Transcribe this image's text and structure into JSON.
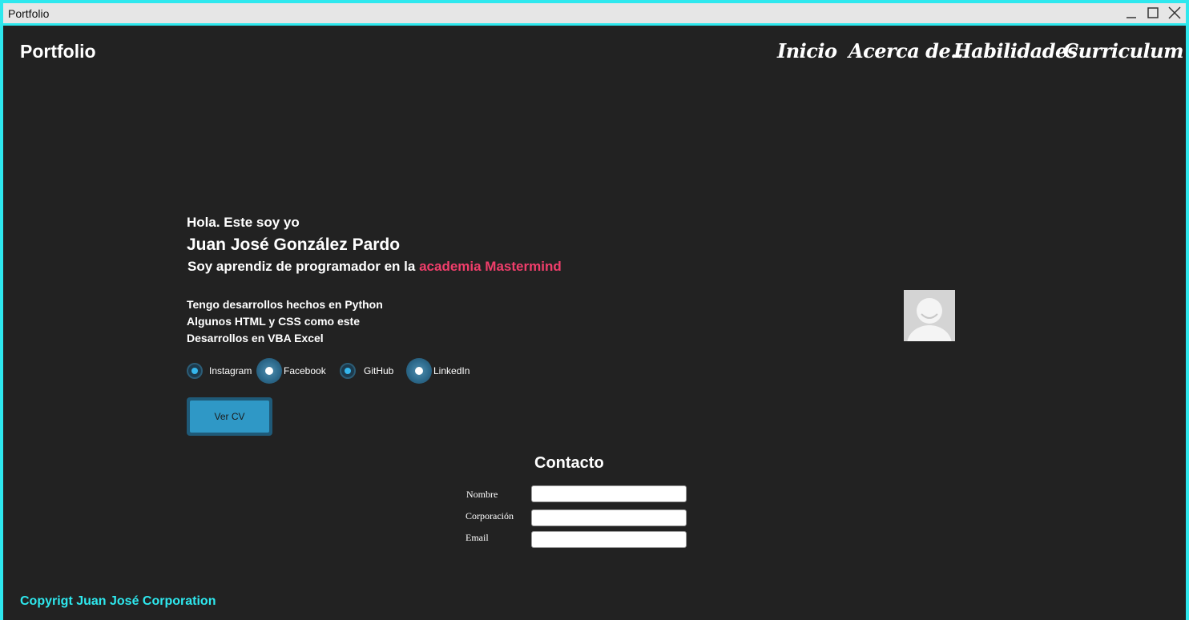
{
  "window": {
    "title": "Portfolio"
  },
  "brand": "Portfolio",
  "nav": {
    "items": [
      {
        "label": "Inicio"
      },
      {
        "label": "Acerca de..."
      },
      {
        "label": "Habilidades"
      },
      {
        "label": "Curriculum"
      }
    ]
  },
  "hero": {
    "greeting": "Hola. Este soy yo",
    "name": "Juan José González Pardo",
    "role_prefix": "Soy aprendiz de programador en la ",
    "role_accent": "academia Mastermind",
    "skills": [
      "Tengo desarrollos hechos en Python",
      "Algunos HTML y CSS como este",
      "Desarrollos en VBA Excel"
    ],
    "accent_color": "#f03e6b"
  },
  "socials": [
    {
      "label": "Instagram",
      "icon": "radio-icon"
    },
    {
      "label": "Facebook",
      "icon": "radio-icon"
    },
    {
      "label": "GitHub",
      "icon": "radio-icon"
    },
    {
      "label": "LinkedIn",
      "icon": "radio-icon"
    }
  ],
  "cv_button": {
    "label": "Ver CV"
  },
  "avatar": {
    "icon": "user-avatar-icon"
  },
  "contact": {
    "title": "Contacto",
    "fields": [
      {
        "label": "Nombre",
        "value": "",
        "placeholder": ""
      },
      {
        "label": "Corporación",
        "value": "",
        "placeholder": ""
      },
      {
        "label": "Email",
        "value": "",
        "placeholder": ""
      }
    ]
  },
  "footer": {
    "copyright": "Copyrigt Juan José Corporation"
  },
  "colors": {
    "frame": "#2ee8ee",
    "background": "#222222",
    "button": "#2f98c6",
    "copyright": "#2ee8ee"
  }
}
